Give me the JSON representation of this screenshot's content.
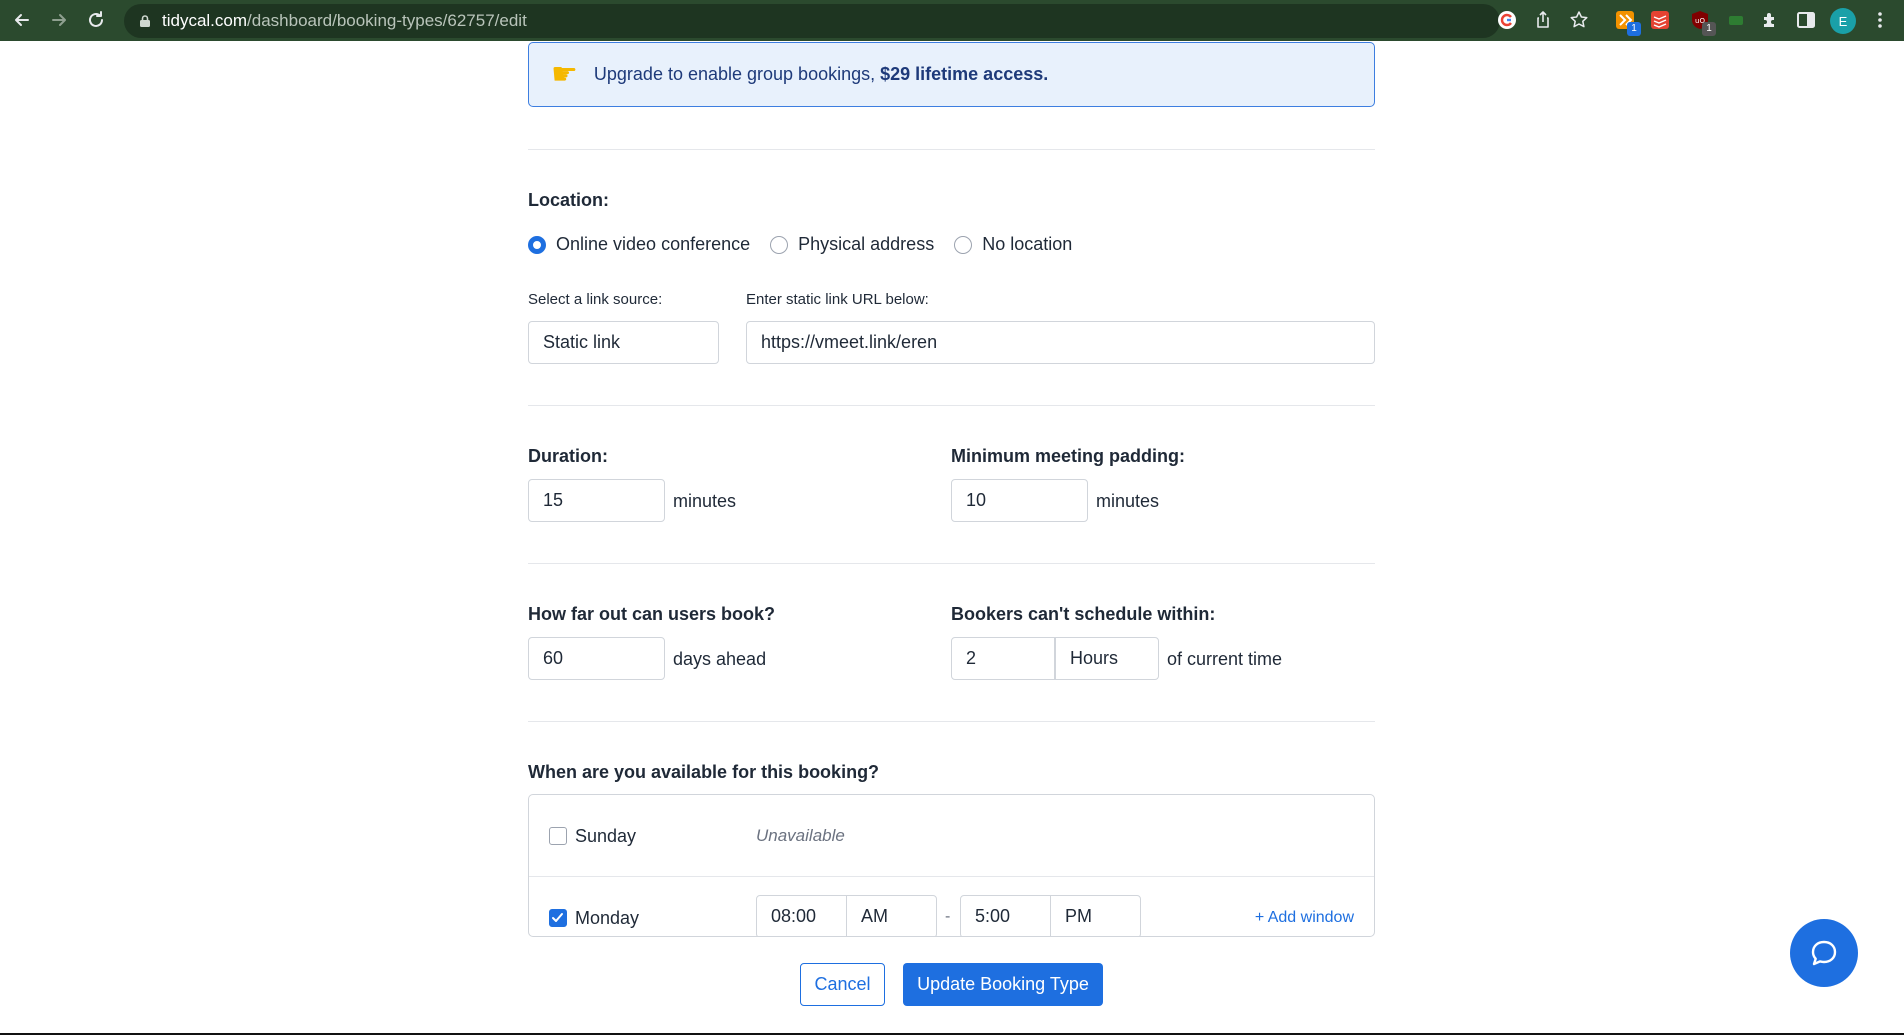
{
  "browser": {
    "url_host": "tidycal.com",
    "url_path": "/dashboard/booking-types/62757/edit",
    "profile_initial": "E",
    "badges": [
      "1",
      "1"
    ]
  },
  "upgrade": {
    "text": "Upgrade to enable group bookings,",
    "strong": "$29 lifetime access."
  },
  "location": {
    "title": "Location:",
    "options": [
      "Online video conference",
      "Physical address",
      "No location"
    ],
    "selected": "Online video conference",
    "link_source_label": "Select a link source:",
    "link_source_value": "Static link",
    "static_url_label": "Enter static link URL below:",
    "static_url_value": "https://vmeet.link/eren"
  },
  "duration": {
    "title": "Duration:",
    "value": "15",
    "unit": "minutes"
  },
  "padding": {
    "title": "Minimum meeting padding:",
    "value": "10",
    "unit": "minutes"
  },
  "booking_window": {
    "title": "How far out can users book?",
    "value": "60",
    "unit": "days ahead"
  },
  "notice": {
    "title": "Bookers can't schedule within:",
    "value": "2",
    "unit_select": "Hours",
    "suffix": "of current time"
  },
  "availability": {
    "title": "When are you available for this booking?",
    "days": [
      {
        "name": "Sunday",
        "checked": false,
        "status": "Unavailable"
      },
      {
        "name": "Monday",
        "checked": true,
        "start": "08:00",
        "start_period": "AM",
        "separator": "-",
        "end": "5:00",
        "end_period": "PM",
        "add_label": "+ Add window"
      }
    ]
  },
  "actions": {
    "cancel": "Cancel",
    "update": "Update Booking Type"
  },
  "colors": {
    "accent": "#1e6fe0",
    "chrome": "#2b4a2e",
    "upgrade_bg": "#e8f1fc"
  },
  "icons": [
    "back-icon",
    "forward-icon",
    "reload-icon",
    "lock-icon",
    "google-icon",
    "share-icon",
    "star-icon",
    "extension-icon",
    "sidebar-icon",
    "menu-icon",
    "hand-pointing-icon",
    "chat-icon"
  ]
}
